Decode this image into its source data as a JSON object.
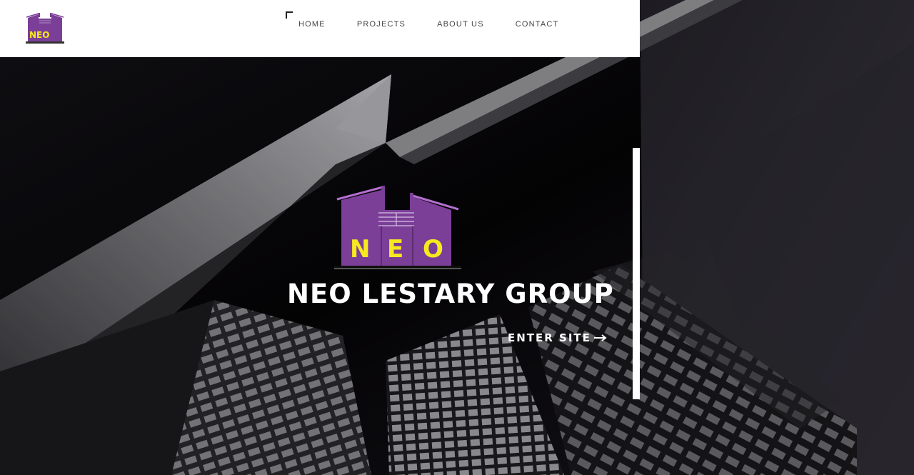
{
  "colors": {
    "brand_purple": "#7b3f98",
    "brand_yellow": "#f6ea1f",
    "header_bg": "#ffffff",
    "hero_text": "#ffffff"
  },
  "header": {
    "logo": {
      "icon": "neo-logo-icon",
      "text": "NEO"
    },
    "nav": [
      {
        "label": "HOME"
      },
      {
        "label": "PROJECTS"
      },
      {
        "label": "ABOUT US"
      },
      {
        "label": "CONTACT"
      }
    ]
  },
  "hero": {
    "logo": {
      "icon": "neo-logo-icon",
      "letters": [
        "N",
        "E",
        "O"
      ]
    },
    "title": "NEO LESTARY GROUP",
    "cta": {
      "label": "ENTER SITE",
      "icon": "arrow-right-icon"
    }
  }
}
